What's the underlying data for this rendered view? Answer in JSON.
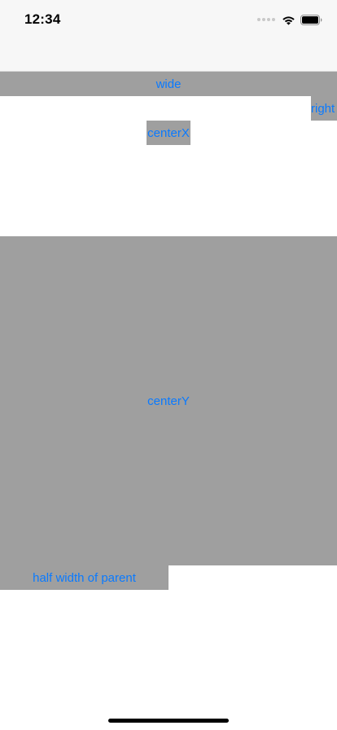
{
  "status_bar": {
    "time": "12:34",
    "icons": [
      "cellular-signal-icon",
      "wifi-icon",
      "battery-icon"
    ]
  },
  "buttons": {
    "wide": "wide",
    "right": "right",
    "center_x": "centerX",
    "center_y": "centerY",
    "half_width": "half width of parent"
  },
  "colors": {
    "status_bar_background": "#f7f7f7",
    "button_background": "#9f9f9f",
    "button_text": "#0a7aff",
    "page_background": "#ffffff",
    "home_indicator": "#000000"
  }
}
